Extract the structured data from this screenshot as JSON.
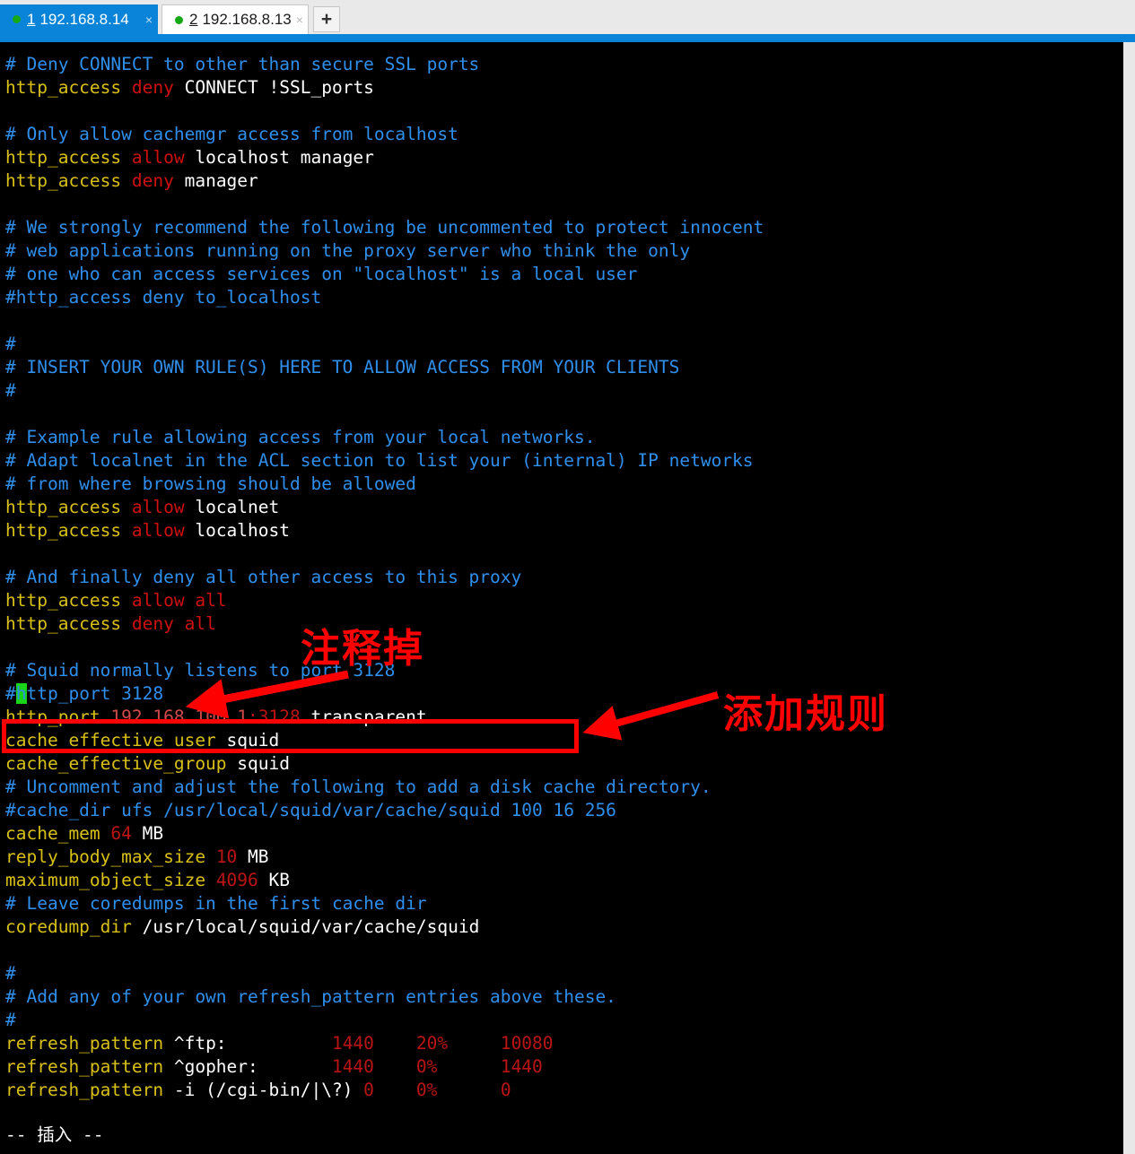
{
  "window": {
    "tabs": [
      {
        "number": "1",
        "label": "192.168.8.14",
        "close": "×",
        "active": true,
        "status_dot": "green-dot"
      },
      {
        "number": "2",
        "label": "192.168.8.13",
        "close": "×",
        "active": false,
        "status_dot": "green-dot"
      }
    ],
    "new_tab_label": "+",
    "accent_color": "#0a84d8"
  },
  "editor": {
    "mode_status": "-- 插入 --",
    "cursor_char": "h",
    "lines": [
      {
        "id": 1,
        "segments": [
          {
            "t": "# Deny CONNECT to other than secure SSL ports",
            "c": "cmt"
          }
        ]
      },
      {
        "id": 2,
        "segments": [
          {
            "t": "http_access ",
            "c": "key"
          },
          {
            "t": "deny",
            "c": "act"
          },
          {
            "t": " CONNECT !SSL_ports",
            "c": "arg"
          }
        ]
      },
      {
        "id": 3,
        "segments": []
      },
      {
        "id": 4,
        "segments": [
          {
            "t": "# Only allow cachemgr access from localhost",
            "c": "cmt"
          }
        ]
      },
      {
        "id": 5,
        "segments": [
          {
            "t": "http_access ",
            "c": "key"
          },
          {
            "t": "allow",
            "c": "act"
          },
          {
            "t": " localhost manager",
            "c": "arg"
          }
        ]
      },
      {
        "id": 6,
        "segments": [
          {
            "t": "http_access ",
            "c": "key"
          },
          {
            "t": "deny",
            "c": "act"
          },
          {
            "t": " manager",
            "c": "arg"
          }
        ]
      },
      {
        "id": 7,
        "segments": []
      },
      {
        "id": 8,
        "segments": [
          {
            "t": "# We strongly recommend the following be uncommented to protect innocent",
            "c": "cmt"
          }
        ]
      },
      {
        "id": 9,
        "segments": [
          {
            "t": "# web applications running on the proxy server who think the only",
            "c": "cmt"
          }
        ]
      },
      {
        "id": 10,
        "segments": [
          {
            "t": "# one who can access services on \"localhost\" is a local user",
            "c": "cmt"
          }
        ]
      },
      {
        "id": 11,
        "segments": [
          {
            "t": "#http_access deny to_localhost",
            "c": "cmt"
          }
        ]
      },
      {
        "id": 12,
        "segments": []
      },
      {
        "id": 13,
        "segments": [
          {
            "t": "#",
            "c": "cmt"
          }
        ]
      },
      {
        "id": 14,
        "segments": [
          {
            "t": "# INSERT YOUR OWN RULE(S) HERE TO ALLOW ACCESS FROM YOUR CLIENTS",
            "c": "cmt"
          }
        ]
      },
      {
        "id": 15,
        "segments": [
          {
            "t": "#",
            "c": "cmt"
          }
        ]
      },
      {
        "id": 16,
        "segments": []
      },
      {
        "id": 17,
        "segments": [
          {
            "t": "# Example rule allowing access from your local networks.",
            "c": "cmt"
          }
        ]
      },
      {
        "id": 18,
        "segments": [
          {
            "t": "# Adapt localnet in the ACL section to list your (internal) IP networks",
            "c": "cmt"
          }
        ]
      },
      {
        "id": 19,
        "segments": [
          {
            "t": "# from where browsing should be allowed",
            "c": "cmt"
          }
        ]
      },
      {
        "id": 20,
        "segments": [
          {
            "t": "http_access ",
            "c": "key"
          },
          {
            "t": "allow",
            "c": "act"
          },
          {
            "t": " localnet",
            "c": "arg"
          }
        ]
      },
      {
        "id": 21,
        "segments": [
          {
            "t": "http_access ",
            "c": "key"
          },
          {
            "t": "allow",
            "c": "act"
          },
          {
            "t": " localhost",
            "c": "arg"
          }
        ]
      },
      {
        "id": 22,
        "segments": []
      },
      {
        "id": 23,
        "segments": [
          {
            "t": "# And finally deny all other access to this proxy",
            "c": "cmt"
          }
        ]
      },
      {
        "id": 24,
        "segments": [
          {
            "t": "http_access ",
            "c": "key"
          },
          {
            "t": "allow all",
            "c": "act"
          }
        ]
      },
      {
        "id": 25,
        "segments": [
          {
            "t": "http_access ",
            "c": "key"
          },
          {
            "t": "deny all",
            "c": "act"
          }
        ]
      },
      {
        "id": 26,
        "segments": []
      },
      {
        "id": 27,
        "segments": [
          {
            "t": "# Squid normally listens to port 3128",
            "c": "cmt"
          }
        ]
      },
      {
        "id": 28,
        "segments": [
          {
            "t": "#",
            "c": "cmt"
          },
          {
            "t": "h",
            "c": "cursor"
          },
          {
            "t": "ttp_port 3128",
            "c": "cmt"
          }
        ]
      },
      {
        "id": 29,
        "segments": [
          {
            "t": "http_port ",
            "c": "key"
          },
          {
            "t": "192.168.100.1",
            "c": "ip"
          },
          {
            "t": ":",
            "c": "num"
          },
          {
            "t": "3128",
            "c": "num"
          },
          {
            "t": " transparent",
            "c": "arg"
          }
        ]
      },
      {
        "id": 30,
        "segments": [
          {
            "t": "cache_effective_user",
            "c": "key"
          },
          {
            "t": " squid",
            "c": "arg"
          }
        ]
      },
      {
        "id": 31,
        "segments": [
          {
            "t": "cache_effective_group",
            "c": "key"
          },
          {
            "t": " squid",
            "c": "arg"
          }
        ]
      },
      {
        "id": 32,
        "segments": [
          {
            "t": "# Uncomment and adjust the following to add a disk cache directory.",
            "c": "cmt"
          }
        ]
      },
      {
        "id": 33,
        "segments": [
          {
            "t": "#cache_dir ufs /usr/local/squid/var/cache/squid 100 16 256",
            "c": "cmt"
          }
        ]
      },
      {
        "id": 34,
        "segments": [
          {
            "t": "cache_mem ",
            "c": "key"
          },
          {
            "t": "64",
            "c": "num"
          },
          {
            "t": " MB",
            "c": "arg"
          }
        ]
      },
      {
        "id": 35,
        "segments": [
          {
            "t": "reply_body_max_size ",
            "c": "key"
          },
          {
            "t": "10",
            "c": "num"
          },
          {
            "t": " MB",
            "c": "arg"
          }
        ]
      },
      {
        "id": 36,
        "segments": [
          {
            "t": "maximum_object_size ",
            "c": "key"
          },
          {
            "t": "4096",
            "c": "num"
          },
          {
            "t": " KB",
            "c": "arg"
          }
        ]
      },
      {
        "id": 37,
        "segments": [
          {
            "t": "# Leave coredumps in the first cache dir",
            "c": "cmt"
          }
        ]
      },
      {
        "id": 38,
        "segments": [
          {
            "t": "coredump_dir",
            "c": "key"
          },
          {
            "t": " /usr/local/squid/var/cache/squid",
            "c": "arg"
          }
        ]
      },
      {
        "id": 39,
        "segments": []
      },
      {
        "id": 40,
        "segments": [
          {
            "t": "#",
            "c": "cmt"
          }
        ]
      },
      {
        "id": 41,
        "segments": [
          {
            "t": "# Add any of your own refresh_pattern entries above these.",
            "c": "cmt"
          }
        ]
      },
      {
        "id": 42,
        "segments": [
          {
            "t": "#",
            "c": "cmt"
          }
        ]
      },
      {
        "id": 43,
        "segments": [
          {
            "t": "refresh_pattern ",
            "c": "key"
          },
          {
            "t": "^ftp:          ",
            "c": "arg"
          },
          {
            "t": "1440",
            "c": "num"
          },
          {
            "t": "    ",
            "c": "arg"
          },
          {
            "t": "20%",
            "c": "num"
          },
          {
            "t": "     ",
            "c": "arg"
          },
          {
            "t": "10080",
            "c": "num"
          }
        ]
      },
      {
        "id": 44,
        "segments": [
          {
            "t": "refresh_pattern ",
            "c": "key"
          },
          {
            "t": "^gopher:       ",
            "c": "arg"
          },
          {
            "t": "1440",
            "c": "num"
          },
          {
            "t": "    ",
            "c": "arg"
          },
          {
            "t": "0%",
            "c": "num"
          },
          {
            "t": "      ",
            "c": "arg"
          },
          {
            "t": "1440",
            "c": "num"
          }
        ]
      },
      {
        "id": 45,
        "segments": [
          {
            "t": "refresh_pattern ",
            "c": "key"
          },
          {
            "t": "-i (/cgi-bin/|\\?) ",
            "c": "arg"
          },
          {
            "t": "0",
            "c": "num"
          },
          {
            "t": "    ",
            "c": "arg"
          },
          {
            "t": "0%",
            "c": "num"
          },
          {
            "t": "      ",
            "c": "arg"
          },
          {
            "t": "0",
            "c": "num"
          }
        ]
      }
    ]
  },
  "annotations": {
    "color": "#fe0000",
    "items": [
      {
        "id": "comment-out",
        "text": "注释掉"
      },
      {
        "id": "add-rule",
        "text": "添加规则"
      }
    ],
    "highlight_box_target": "http_port 192.168.100.1:3128 transparent"
  }
}
